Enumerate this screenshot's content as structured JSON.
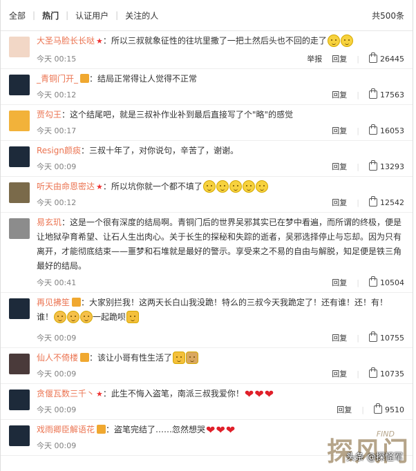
{
  "tabs": [
    "全部",
    "热门",
    "认证用户",
    "关注的人"
  ],
  "total": "共500条",
  "actions": {
    "report": "举报",
    "reply": "回复"
  },
  "comments": [
    {
      "user": "大圣马脸长长哒",
      "text": "：所以三叔就象征性的往坑里撒了一把土然后头也不回的走了",
      "time": "今天 00:15",
      "likes": "26445",
      "report": true,
      "star": true,
      "emojis": 2,
      "av": "#f2d7c6"
    },
    {
      "user": "_青铜门开_",
      "text": "：结局正常得让人觉得不正常",
      "time": "今天 00:12",
      "likes": "17563",
      "badge": true,
      "av": "#1d2a3a"
    },
    {
      "user": "贾勾王",
      "text": "：这个结尾吧，就是三叔补作业补到最后直接写了个\"略\"的感觉",
      "time": "今天 00:17",
      "likes": "16053",
      "av": "#f2b23a"
    },
    {
      "user": "Resign颜痰",
      "text": "：三叔十年了，对你说句，辛苦了，谢谢。",
      "time": "今天 00:09",
      "likes": "13293",
      "av": "#1d2a3a"
    },
    {
      "user": "听天由命恩密达",
      "text": "：所以坑你就一个都不填了",
      "time": "今天 00:12",
      "likes": "12542",
      "star": true,
      "emojis": 5,
      "av": "#7a6a4a"
    },
    {
      "user": "易玄玑",
      "text": "：这是一个很有深度的结局啊。青铜门后的世界吴邪其实已在梦中看遍，而所谓的终极，便是让地狱孕育希望、让石人生出肉心。关于长生的探秘和失踪的逝者，吴邪选择停止与忘却。因为只有离开，才能彻底结束——噩梦和石堆就是最好的警示。享受来之不易的自由与解脱，知足便是铁三角最好的结局。",
      "time": "今天 00:41",
      "likes": "10504",
      "av": "#8c8c8c"
    },
    {
      "user": "再见拂笙",
      "text": "：大家别拦我！这两天长白山我没跪！特么的三叔今天我跪定了！还有谁！还！有！谁！",
      "text2": "一起跪呗",
      "time": "今天 00:09",
      "likes": "10755",
      "badge": true,
      "av": "#1d2a3a"
    },
    {
      "user": "仙人不倚楼",
      "text": "：该让小哥有性生活了",
      "time": "今天 00:09",
      "likes": "10735",
      "badge": true,
      "av": "#4a3a3a"
    },
    {
      "user": "贪偃瓦数三千丶",
      "text": "：此生不悔入盗笔，南派三叔我爱你！",
      "time": "今天 00:09",
      "likes": "9510",
      "star": true,
      "hearts": 3,
      "av": "#1d2a3a"
    },
    {
      "user": "戏雨卿臣解语花",
      "text": "：盗笔完结了……忽然想哭",
      "time": "今天 00:09",
      "likes": "",
      "badge": true,
      "hearts": 3,
      "av": "#1d2a3a"
    }
  ],
  "watermark": {
    "big": "探风门",
    "find": "FIND",
    "text": "头条 @探怪军"
  }
}
